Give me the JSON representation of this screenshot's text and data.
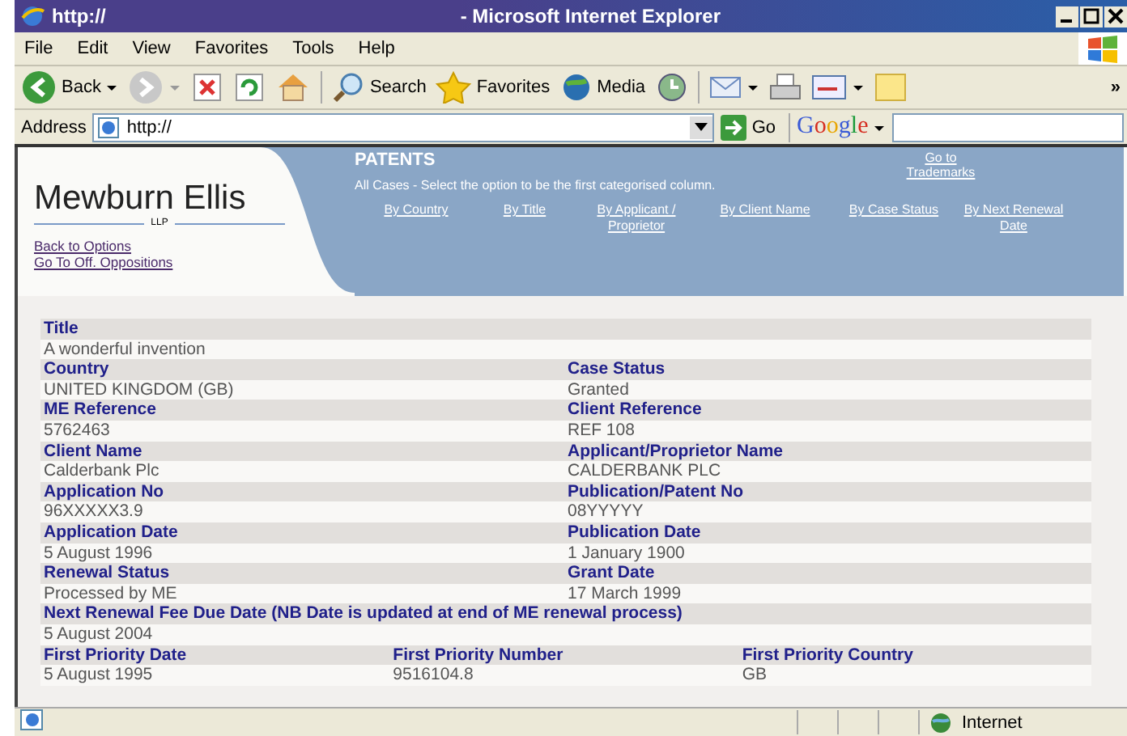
{
  "window": {
    "title_url": "http://",
    "title": "- Microsoft Internet Explorer"
  },
  "menu": [
    "File",
    "Edit",
    "View",
    "Favorites",
    "Tools",
    "Help"
  ],
  "toolbar": {
    "back": "Back",
    "search": "Search",
    "favorites": "Favorites",
    "media": "Media",
    "more": "»"
  },
  "address_bar": {
    "label": "Address",
    "value": "http://",
    "go": "Go",
    "google": "Google"
  },
  "header": {
    "brand": "Mewburn Ellis",
    "brand_sub": "LLP",
    "links": [
      "Back to Options",
      "Go To Off. Oppositions"
    ],
    "heading": "PATENTS",
    "note": "All Cases - Select the option to be the first categorised column.",
    "trademarks_link": "Go to Trademarks",
    "sort_links": [
      "By Country",
      "By Title",
      "By Applicant / Proprietor",
      "By Client Name",
      "By Case Status",
      "By Next Renewal Date"
    ]
  },
  "details": [
    [
      {
        "label": "Title",
        "value": "A wonderful invention"
      }
    ],
    [
      {
        "label": "Country",
        "value": "UNITED KINGDOM (GB)"
      },
      {
        "label": "Case Status",
        "value": "Granted"
      }
    ],
    [
      {
        "label": "ME Reference",
        "value": "5762463"
      },
      {
        "label": "Client Reference",
        "value": "REF 108"
      }
    ],
    [
      {
        "label": "Client Name",
        "value": "Calderbank Plc"
      },
      {
        "label": "Applicant/Proprietor Name",
        "value": "CALDERBANK PLC"
      }
    ],
    [
      {
        "label": "Application No",
        "value": "96XXXXX3.9"
      },
      {
        "label": "Publication/Patent No",
        "value": "08YYYYY"
      }
    ],
    [
      {
        "label": "Application Date",
        "value": "5 August 1996"
      },
      {
        "label": "Publication Date",
        "value": "1 January 1900"
      }
    ],
    [
      {
        "label": "Renewal Status",
        "value": "Processed by ME"
      },
      {
        "label": "Grant Date",
        "value": "17 March 1999"
      }
    ],
    [
      {
        "label": "Next Renewal Fee Due Date (NB Date is updated at end of ME renewal process)",
        "value": "5 August 2004"
      }
    ],
    [
      {
        "label": "First Priority Date",
        "value": "5 August 1995"
      },
      {
        "label": "First Priority Number",
        "value": "9516104.8"
      },
      {
        "label": "First Priority Country",
        "value": "GB"
      }
    ]
  ],
  "status_bar": {
    "zone": "Internet"
  }
}
